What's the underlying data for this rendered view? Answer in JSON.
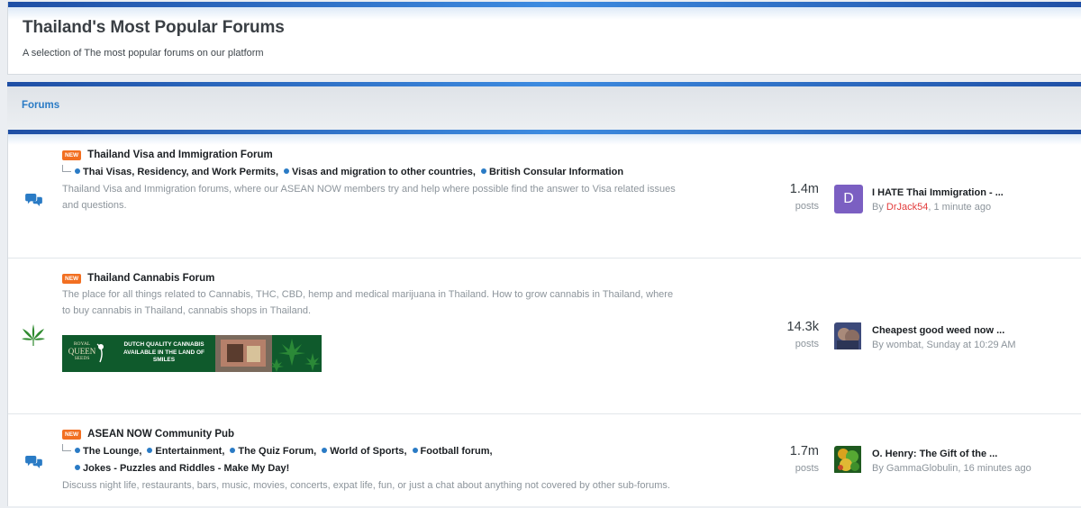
{
  "header": {
    "title": "Thailand's Most Popular Forums",
    "description": "A selection of The most popular forums on our platform"
  },
  "section": {
    "title": "Forums"
  },
  "forums": [
    {
      "badge": "NEW",
      "title": "Thailand Visa and Immigration Forum",
      "icon": "chat-bubbles-icon",
      "subforums": [
        "Thai Visas, Residency, and Work Permits,",
        "Visas and migration to other countries,",
        "British Consular Information"
      ],
      "description_1": "Thailand Visa and Immigration forums, where our ASEAN NOW members try and help where possible find the answer to Visa related issues",
      "description_2": "and questions.",
      "stat_value": "1.4m",
      "stat_label": "posts",
      "latest_title": "I HATE Thai Immigration - ...",
      "latest_by": "By",
      "latest_user": "DrJack54",
      "latest_time": ", 1 minute ago",
      "avatar_letter": "D"
    },
    {
      "badge": "NEW",
      "title": "Thailand Cannabis Forum",
      "icon": "cannabis-leaf-icon",
      "description_1": "The place for all things related to Cannabis, THC, CBD, hemp and medical marijuana in Thailand. How to grow cannabis in Thailand, where",
      "description_2": "to buy cannabis in Thailand, cannabis shops in Thailand.",
      "banner": {
        "brand_1": "ROYAL",
        "brand_2": "QUEEN",
        "brand_3": "SEEDS",
        "text_1": "DUTCH QUALITY CANNABIS",
        "text_2": "AVAILABLE IN THE LAND OF",
        "text_3": "SMILES"
      },
      "stat_value": "14.3k",
      "stat_label": "posts",
      "latest_title": "Cheapest good weed now ...",
      "latest_meta": "By wombat, Sunday at 10:29 AM"
    },
    {
      "badge": "NEW",
      "title": "ASEAN NOW Community Pub",
      "icon": "chat-bubbles-icon",
      "subforums": [
        "The Lounge,",
        "Entertainment,",
        "The Quiz Forum,",
        "World of Sports,",
        "Football forum,",
        "Jokes - Puzzles and Riddles - Make My Day!"
      ],
      "description_1": "Discuss night life, restaurants, bars, music, movies, concerts, expat life, fun, or just a chat about anything not covered by other sub-forums.",
      "stat_value": "1.7m",
      "stat_label": "posts",
      "latest_title": "O. Henry: The Gift of the ...",
      "latest_meta": "By GammaGlobulin, 16 minutes ago"
    }
  ],
  "colors": {
    "accent": "#2a7bc5",
    "badge": "#f26f21",
    "bar": "#1f4fa5"
  }
}
